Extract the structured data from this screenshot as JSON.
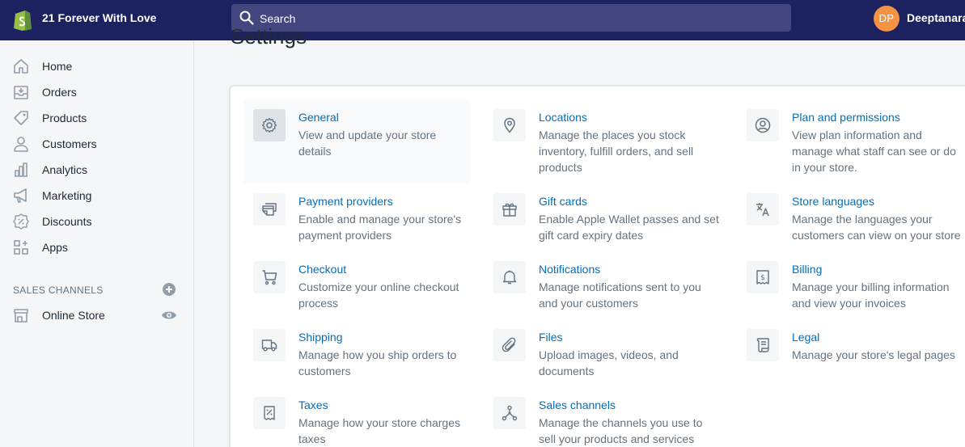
{
  "topbar": {
    "store_name": "21 Forever With Love",
    "search_placeholder": "Search",
    "avatar_initials": "DP",
    "user_name": "Deeptanara"
  },
  "sidebar": {
    "items": [
      {
        "label": "Home",
        "icon": "home-icon"
      },
      {
        "label": "Orders",
        "icon": "orders-icon"
      },
      {
        "label": "Products",
        "icon": "tag-icon"
      },
      {
        "label": "Customers",
        "icon": "person-icon"
      },
      {
        "label": "Analytics",
        "icon": "bar-chart-icon"
      },
      {
        "label": "Marketing",
        "icon": "megaphone-icon"
      },
      {
        "label": "Discounts",
        "icon": "discount-icon"
      },
      {
        "label": "Apps",
        "icon": "apps-icon"
      }
    ],
    "sales_channels_title": "SALES CHANNELS",
    "channels": [
      {
        "label": "Online Store",
        "icon": "store-icon"
      }
    ]
  },
  "main": {
    "title": "Settings",
    "settings": [
      {
        "title": "General",
        "desc": "View and update your store details",
        "icon": "gear-icon"
      },
      {
        "title": "Locations",
        "desc": "Manage the places you stock inventory, fulfill orders, and sell products",
        "icon": "location-pin-icon"
      },
      {
        "title": "Plan and permissions",
        "desc": "View plan information and manage what staff can see or do in your store.",
        "icon": "account-icon"
      },
      {
        "title": "Payment providers",
        "desc": "Enable and manage your store's payment providers",
        "icon": "payment-icon"
      },
      {
        "title": "Gift cards",
        "desc": "Enable Apple Wallet passes and set gift card expiry dates",
        "icon": "gift-icon"
      },
      {
        "title": "Store languages",
        "desc": "Manage the languages your customers can view on your store",
        "icon": "translate-icon"
      },
      {
        "title": "Checkout",
        "desc": "Customize your online checkout process",
        "icon": "cart-icon"
      },
      {
        "title": "Notifications",
        "desc": "Manage notifications sent to you and your customers",
        "icon": "bell-icon"
      },
      {
        "title": "Billing",
        "desc": "Manage your billing information and view your invoices",
        "icon": "billing-icon"
      },
      {
        "title": "Shipping",
        "desc": "Manage how you ship orders to customers",
        "icon": "truck-icon"
      },
      {
        "title": "Files",
        "desc": "Upload images, videos, and documents",
        "icon": "paperclip-icon"
      },
      {
        "title": "Legal",
        "desc": "Manage your store's legal pages",
        "icon": "legal-icon"
      },
      {
        "title": "Taxes",
        "desc": "Manage how your store charges taxes",
        "icon": "tax-receipt-icon"
      },
      {
        "title": "Sales channels",
        "desc": "Manage the channels you use to sell your products and services",
        "icon": "sales-channels-icon"
      }
    ]
  },
  "colors": {
    "topbar": "#1c2260",
    "link": "#006fbb",
    "avatar": "#f49342",
    "shopify_green": "#95bf47"
  }
}
